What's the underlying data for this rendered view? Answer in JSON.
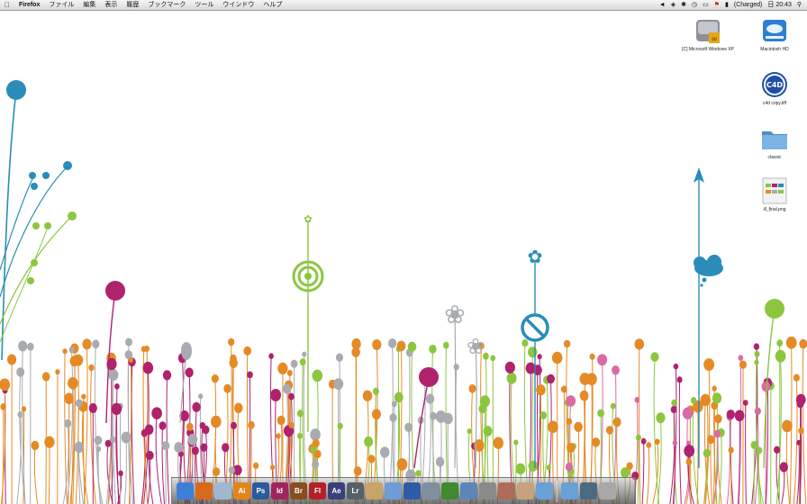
{
  "menubar": {
    "app_name": "Firefox",
    "menus": [
      "ファイル",
      "編集",
      "表示",
      "履歴",
      "ブックマーク",
      "ツール",
      "ウインドウ",
      "ヘルプ"
    ],
    "battery_status": "(Charged)",
    "clock": "日 20:43",
    "icons": [
      "apple-icon",
      "volume-icon",
      "wifi-icon",
      "bluetooth-icon",
      "time-machine-icon",
      "display-icon",
      "flag-icon",
      "battery-icon",
      "spotlight-icon"
    ]
  },
  "desktop_icons": [
    {
      "label": "[C] Microsoft Windows XP",
      "icon": "hard-drive-icon"
    },
    {
      "label": "Macintosh HD",
      "icon": "hard-drive-icon"
    },
    {
      "label": "c4d copy.tiff",
      "icon": "image-file-icon"
    },
    {
      "label": "classic",
      "icon": "folder-icon"
    },
    {
      "label": "ill_final.png",
      "icon": "image-file-icon"
    }
  ],
  "dock": {
    "apps": [
      {
        "name": "finder-icon",
        "text": "",
        "color": "#3d7fd6"
      },
      {
        "name": "firefox-icon",
        "text": "",
        "color": "#d86a1c"
      },
      {
        "name": "mail-icon",
        "text": "",
        "color": "#9fb8d0"
      },
      {
        "name": "illustrator-icon",
        "text": "Ai",
        "color": "#e2861b"
      },
      {
        "name": "photoshop-icon",
        "text": "Ps",
        "color": "#2c5a9c"
      },
      {
        "name": "indesign-icon",
        "text": "Id",
        "color": "#a0235e"
      },
      {
        "name": "bridge-icon",
        "text": "Br",
        "color": "#8a4d1e"
      },
      {
        "name": "flash-icon",
        "text": "Fl",
        "color": "#b3202a"
      },
      {
        "name": "after-effects-icon",
        "text": "Ae",
        "color": "#3b3f7a"
      },
      {
        "name": "lightroom-icon",
        "text": "Lr",
        "color": "#55606b"
      },
      {
        "name": "paint-palette-icon",
        "text": "",
        "color": "#c9a46a"
      },
      {
        "name": "itunes-icon",
        "text": "",
        "color": "#6e9cd6"
      },
      {
        "name": "cinema4d-icon",
        "text": "",
        "color": "#2f5aa8"
      },
      {
        "name": "screenshot-icon",
        "text": "",
        "color": "#7f8f9b"
      },
      {
        "name": "windows-start-icon",
        "text": "",
        "color": "#3f8a2e"
      },
      {
        "name": "app-store-icon",
        "text": "",
        "color": "#5c86b8"
      },
      {
        "name": "apple-logo-icon",
        "text": "",
        "color": "#8a8a8a"
      },
      {
        "name": "photo-icon",
        "text": "",
        "color": "#b06a58"
      },
      {
        "name": "cartoon-icon",
        "text": "",
        "color": "#c7a27e"
      },
      {
        "name": "folder-stack-icon",
        "text": "",
        "color": "#6aa0d8"
      },
      {
        "name": "folder-stack-icon-2",
        "text": "",
        "color": "#6aa0d8"
      },
      {
        "name": "preview-icon",
        "text": "",
        "color": "#4a6a80"
      },
      {
        "name": "trash-icon",
        "text": "",
        "color": "#a8a8a8"
      }
    ]
  },
  "colors": {
    "teal": "#2a8cb8",
    "green": "#8cc63f",
    "magenta": "#b0226e",
    "orange": "#e58a25",
    "gray": "#a8abb0",
    "pink": "#d96aa5"
  }
}
